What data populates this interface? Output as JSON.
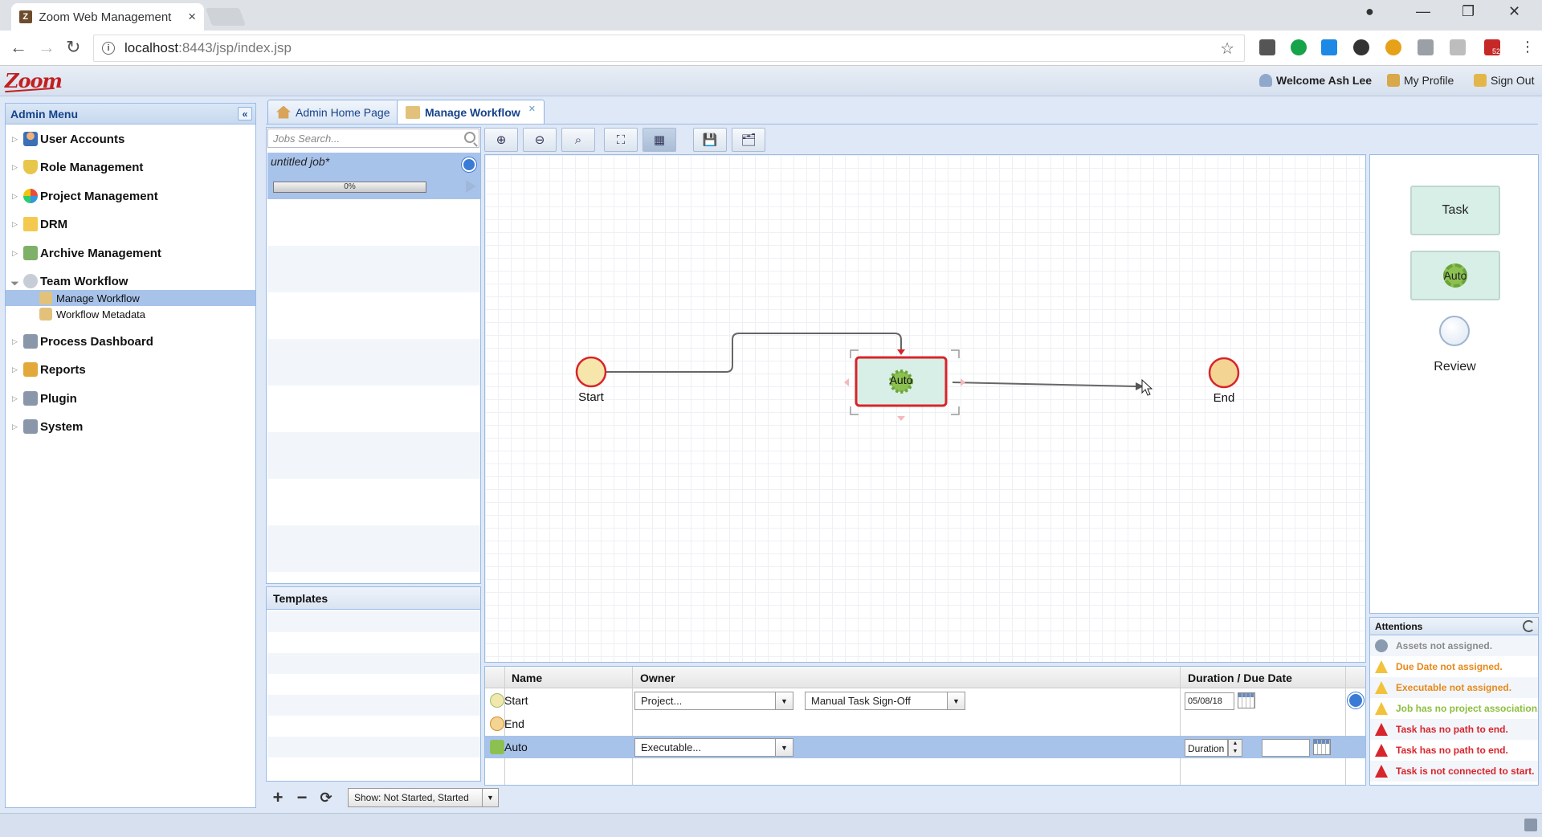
{
  "browser": {
    "tab_title": "Zoom Web Management",
    "tab_close": "×",
    "url_host": "localhost",
    "url_rest": ":8443/jsp/index.jsp",
    "extension_badge": "52"
  },
  "app": {
    "logo": "Zoom",
    "welcome": "Welcome Ash Lee",
    "my_profile": "My Profile",
    "sign_out": "Sign Out"
  },
  "admin_menu": {
    "title": "Admin Menu",
    "items": [
      {
        "label": "User Accounts",
        "icon": "user-icon"
      },
      {
        "label": "Role Management",
        "icon": "shield-icon"
      },
      {
        "label": "Project Management",
        "icon": "globe-icon"
      },
      {
        "label": "DRM",
        "icon": "folder-icon"
      },
      {
        "label": "Archive Management",
        "icon": "archive-icon"
      },
      {
        "label": "Team Workflow",
        "icon": "workflow-icon"
      },
      {
        "label": "Process Dashboard",
        "icon": "dashboard-icon"
      },
      {
        "label": "Reports",
        "icon": "reports-icon"
      },
      {
        "label": "Plugin",
        "icon": "plugin-icon"
      },
      {
        "label": "System",
        "icon": "system-icon"
      }
    ],
    "sub_items": [
      {
        "label": "Manage Workflow",
        "selected": true
      },
      {
        "label": "Workflow Metadata",
        "selected": false
      }
    ]
  },
  "tabs": [
    {
      "label": "Admin Home Page",
      "active": false
    },
    {
      "label": "Manage Workflow",
      "active": true
    }
  ],
  "jobs": {
    "search_placeholder": "Jobs Search...",
    "job_name": "untitled job*",
    "progress_label": "0%",
    "progress": 0
  },
  "templates": {
    "title": "Templates"
  },
  "footer": {
    "add": "+",
    "remove": "−",
    "refresh": "⟳",
    "show_filter": "Show: Not Started, Started"
  },
  "toolbar": {
    "buttons": [
      "zoom-in-icon",
      "zoom-out-icon",
      "zoom-reset-icon",
      "fit-icon",
      "grid-icon",
      "save-icon",
      "save-as-icon"
    ]
  },
  "canvas": {
    "start_label": "Start",
    "auto_label": "Auto",
    "end_label": "End"
  },
  "palette": {
    "task": "Task",
    "auto": "Auto",
    "review": "Review"
  },
  "attentions": {
    "title": "Attentions",
    "items": [
      {
        "type": "info",
        "text": "Assets not assigned.",
        "color": "#8a8a8a"
      },
      {
        "type": "warning",
        "text": "Due Date not assigned.",
        "color": "#e8891a"
      },
      {
        "type": "warning",
        "text": "Executable not assigned.",
        "color": "#e8891a"
      },
      {
        "type": "warning",
        "text": "Job has no project association.",
        "color": "#8cbf3f"
      },
      {
        "type": "error",
        "text": "Task has no path to end.",
        "color": "#d8242c"
      },
      {
        "type": "error",
        "text": "Task has no path to end.",
        "color": "#d8242c"
      },
      {
        "type": "error",
        "text": "Task is not connected to start.",
        "color": "#d8242c"
      }
    ]
  },
  "grid": {
    "headers": {
      "name": "Name",
      "owner": "Owner",
      "duration": "Duration / Due Date"
    },
    "rows": [
      {
        "name": "Start",
        "owner": "Project...",
        "owner2": "Manual Task Sign-Off",
        "date": "05/08/18"
      },
      {
        "name": "End"
      },
      {
        "name": "Auto",
        "owner": "Executable...",
        "duration": "Duration"
      }
    ]
  }
}
